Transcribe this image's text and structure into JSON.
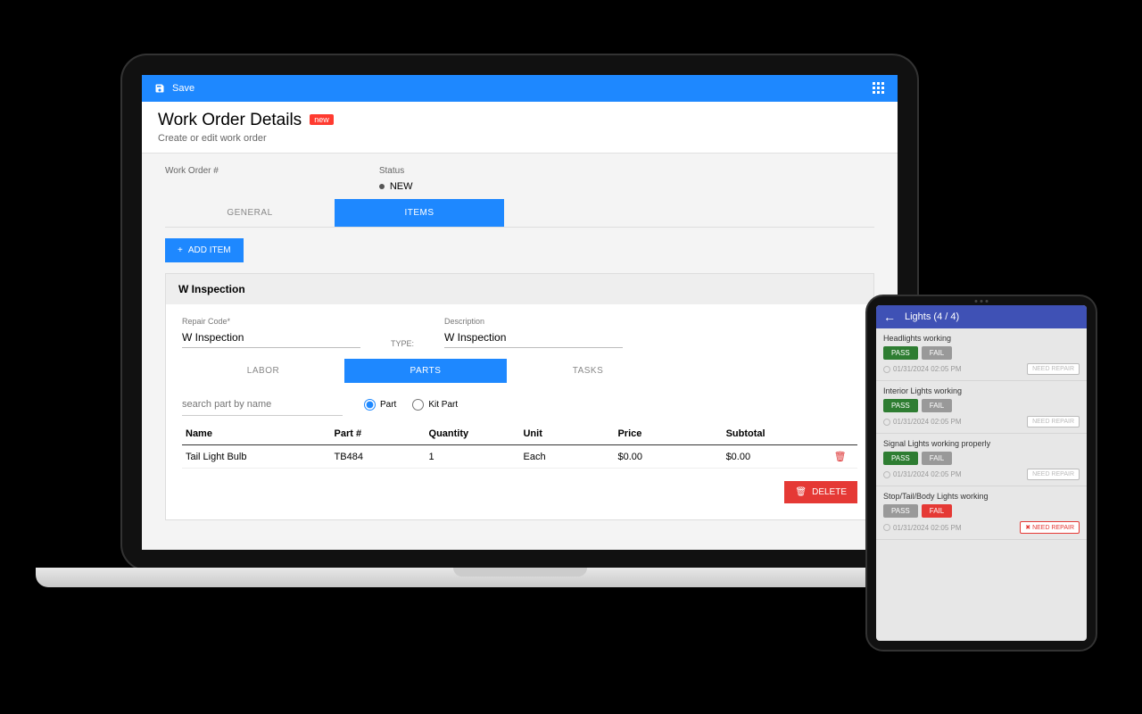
{
  "laptop": {
    "topbar": {
      "save": "Save"
    },
    "header": {
      "title": "Work Order Details",
      "badge": "new",
      "subtitle": "Create or edit work order"
    },
    "fields": {
      "work_order_label": "Work Order #",
      "status_label": "Status",
      "status_value": "NEW"
    },
    "tabs": {
      "general": "GENERAL",
      "items": "ITEMS"
    },
    "add_item": "ADD ITEM",
    "panel": {
      "title": "W Inspection",
      "repair_code_label": "Repair Code*",
      "repair_code_value": "W Inspection",
      "type_label": "TYPE:",
      "desc_label": "Description",
      "desc_value": "W Inspection"
    },
    "subtabs": {
      "labor": "LABOR",
      "parts": "PARTS",
      "tasks": "TASKS"
    },
    "search": {
      "placeholder": "search part by name",
      "radio_part": "Part",
      "radio_kit": "Kit Part"
    },
    "table": {
      "cols": {
        "name": "Name",
        "partno": "Part #",
        "qty": "Quantity",
        "unit": "Unit",
        "price": "Price",
        "subtotal": "Subtotal"
      },
      "row": {
        "name": "Tail Light Bulb",
        "partno": "TB484",
        "qty": "1",
        "unit": "Each",
        "price": "$0.00",
        "subtotal": "$0.00"
      }
    },
    "delete": "DELETE"
  },
  "tablet": {
    "title": "Lights (4 / 4)",
    "pass": "PASS",
    "fail": "FAIL",
    "need_repair": "NEED REPAIR",
    "items": [
      {
        "title": "Headlights working",
        "ts": "01/31/2024 02:05 PM",
        "result": "pass",
        "repair_active": false
      },
      {
        "title": "Interior Lights working",
        "ts": "01/31/2024 02:05 PM",
        "result": "pass",
        "repair_active": false
      },
      {
        "title": "Signal Lights working properly",
        "ts": "01/31/2024 02:05 PM",
        "result": "pass",
        "repair_active": false
      },
      {
        "title": "Stop/Tail/Body Lights working",
        "ts": "01/31/2024 02:05 PM",
        "result": "fail",
        "repair_active": true
      }
    ]
  }
}
